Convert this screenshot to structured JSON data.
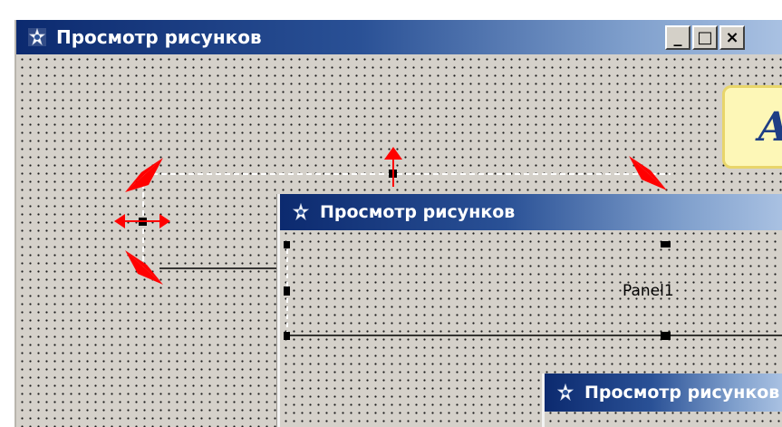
{
  "windows": [
    {
      "title": "Просмотр рисунков"
    },
    {
      "title": "Просмотр рисунков"
    },
    {
      "title": "Просмотр рисунков"
    }
  ],
  "window_buttons": {
    "minimize": "_",
    "maximize": "□",
    "close": "×"
  },
  "panel": {
    "caption": "Panel1"
  },
  "callout": {
    "text": "А"
  },
  "colors": {
    "arrow": "#ff0000",
    "titlebar_start": "#0c2a6f",
    "titlebar_end": "#a9c1e2",
    "form_bg": "#d5d1ca"
  }
}
